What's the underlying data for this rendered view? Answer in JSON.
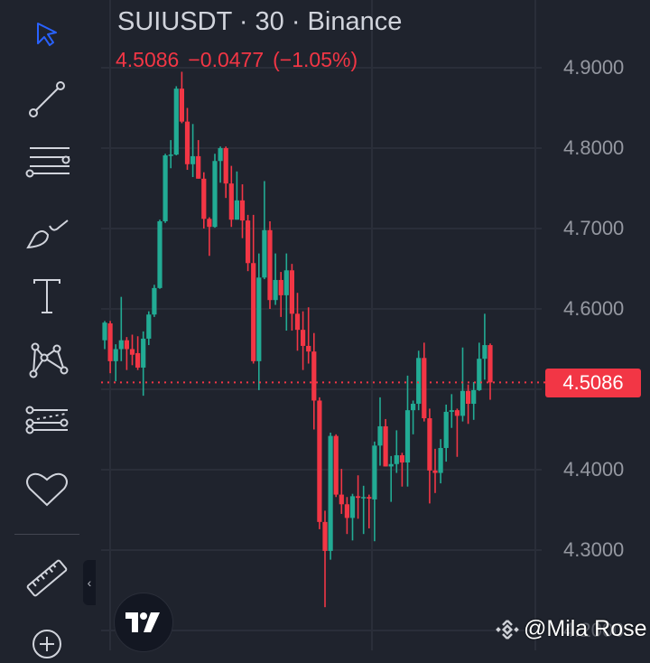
{
  "header": {
    "title": "SUIUSDT · 30 · Binance",
    "last": "4.5086",
    "change": "−0.0477",
    "change_pct": "(−1.05%)"
  },
  "price_scale": {
    "labels": [
      "4.9000",
      "4.8000",
      "4.7000",
      "4.6000",
      "4.4000",
      "4.3000",
      "4.2000"
    ],
    "last_price_label": "4.5086"
  },
  "toolbar": {
    "tools": [
      "cursor-icon",
      "trend-line-icon",
      "parallel-channel-icon",
      "brush-icon",
      "text-icon",
      "pattern-icon",
      "forecast-icon",
      "favorites-heart-icon",
      "ruler-icon",
      "zoom-in-plus-icon"
    ],
    "collapse_label": "‹"
  },
  "watermark": {
    "text": "@Mila Rose"
  },
  "colors": {
    "up": "#22ab94",
    "down": "#f23645",
    "background": "#1f232d",
    "grid": "#2a2e39",
    "cursor": "#2962ff"
  },
  "chart_data": {
    "type": "candlestick",
    "symbol": "SUIUSDT",
    "interval": "30",
    "exchange": "Binance",
    "ylim": [
      4.18,
      4.92
    ],
    "yticks": [
      4.9,
      4.8,
      4.7,
      4.6,
      4.5,
      4.4,
      4.3,
      4.2
    ],
    "last_price": 4.5086,
    "ohlc": [
      [
        4.561,
        4.585,
        4.55,
        4.583
      ],
      [
        4.582,
        4.585,
        4.52,
        4.535
      ],
      [
        4.535,
        4.556,
        4.51,
        4.55
      ],
      [
        4.55,
        4.615,
        4.535,
        4.561
      ],
      [
        4.561,
        4.565,
        4.524,
        4.55
      ],
      [
        4.55,
        4.568,
        4.53,
        4.543
      ],
      [
        4.545,
        4.566,
        4.524,
        4.527
      ],
      [
        4.527,
        4.572,
        4.492,
        4.563
      ],
      [
        4.563,
        4.597,
        4.555,
        4.593
      ],
      [
        4.593,
        4.63,
        4.59,
        4.626
      ],
      [
        4.626,
        4.711,
        4.625,
        4.709
      ],
      [
        4.709,
        4.793,
        4.707,
        4.791
      ],
      [
        4.791,
        4.81,
        4.775,
        4.792
      ],
      [
        4.792,
        4.877,
        4.791,
        4.874
      ],
      [
        4.874,
        4.895,
        4.831,
        4.833
      ],
      [
        4.833,
        4.85,
        4.773,
        4.78
      ],
      [
        4.78,
        4.83,
        4.764,
        4.79
      ],
      [
        4.79,
        4.81,
        4.762,
        4.762
      ],
      [
        4.762,
        4.77,
        4.7,
        4.712
      ],
      [
        4.712,
        4.714,
        4.666,
        4.702
      ],
      [
        4.702,
        4.793,
        4.701,
        4.784
      ],
      [
        4.784,
        4.802,
        4.757,
        4.8
      ],
      [
        4.8,
        4.802,
        4.738,
        4.756
      ],
      [
        4.756,
        4.778,
        4.702,
        4.711
      ],
      [
        4.711,
        4.771,
        4.711,
        4.735
      ],
      [
        4.735,
        4.755,
        4.688,
        4.71
      ],
      [
        4.71,
        4.717,
        4.647,
        4.657
      ],
      [
        4.657,
        4.717,
        4.532,
        4.535
      ],
      [
        4.535,
        4.669,
        4.499,
        4.639
      ],
      [
        4.639,
        4.759,
        4.637,
        4.698
      ],
      [
        4.698,
        4.709,
        4.6,
        4.611
      ],
      [
        4.611,
        4.669,
        4.605,
        4.636
      ],
      [
        4.636,
        4.646,
        4.59,
        4.617
      ],
      [
        4.617,
        4.669,
        4.573,
        4.648
      ],
      [
        4.648,
        4.656,
        4.573,
        4.594
      ],
      [
        4.594,
        4.62,
        4.548,
        4.574
      ],
      [
        4.574,
        4.597,
        4.524,
        4.554
      ],
      [
        4.554,
        4.602,
        4.532,
        4.547
      ],
      [
        4.547,
        4.57,
        4.45,
        4.486
      ],
      [
        4.486,
        4.49,
        4.326,
        4.335
      ],
      [
        4.335,
        4.349,
        4.229,
        4.299
      ],
      [
        4.299,
        4.446,
        4.288,
        4.442
      ],
      [
        4.442,
        4.444,
        4.366,
        4.369
      ],
      [
        4.369,
        4.401,
        4.345,
        4.357
      ],
      [
        4.357,
        4.366,
        4.32,
        4.34
      ],
      [
        4.34,
        4.37,
        4.312,
        4.367
      ],
      [
        4.367,
        4.393,
        4.339,
        4.365
      ],
      [
        4.365,
        4.38,
        4.32,
        4.366
      ],
      [
        4.366,
        4.369,
        4.327,
        4.364
      ],
      [
        4.363,
        4.435,
        4.311,
        4.43
      ],
      [
        4.43,
        4.49,
        4.405,
        4.454
      ],
      [
        4.454,
        4.463,
        4.404,
        4.404
      ],
      [
        4.404,
        4.417,
        4.36,
        4.407
      ],
      [
        4.407,
        4.449,
        4.396,
        4.418
      ],
      [
        4.418,
        4.421,
        4.379,
        4.409
      ],
      [
        4.409,
        4.517,
        4.379,
        4.474
      ],
      [
        4.474,
        4.486,
        4.444,
        4.482
      ],
      [
        4.482,
        4.548,
        4.474,
        4.539
      ],
      [
        4.539,
        4.558,
        4.46,
        4.464
      ],
      [
        4.464,
        4.476,
        4.358,
        4.399
      ],
      [
        4.399,
        4.426,
        4.371,
        4.396
      ],
      [
        4.396,
        4.438,
        4.383,
        4.427
      ],
      [
        4.427,
        4.481,
        4.41,
        4.472
      ],
      [
        4.472,
        4.494,
        4.452,
        4.474
      ],
      [
        4.474,
        4.476,
        4.416,
        4.467
      ],
      [
        4.467,
        4.552,
        4.46,
        4.498
      ],
      [
        4.498,
        4.506,
        4.457,
        4.482
      ],
      [
        4.482,
        4.509,
        4.462,
        4.499
      ],
      [
        4.499,
        4.558,
        4.498,
        4.538
      ],
      [
        4.538,
        4.594,
        4.512,
        4.555
      ],
      [
        4.555,
        4.557,
        4.487,
        4.5086
      ]
    ]
  }
}
